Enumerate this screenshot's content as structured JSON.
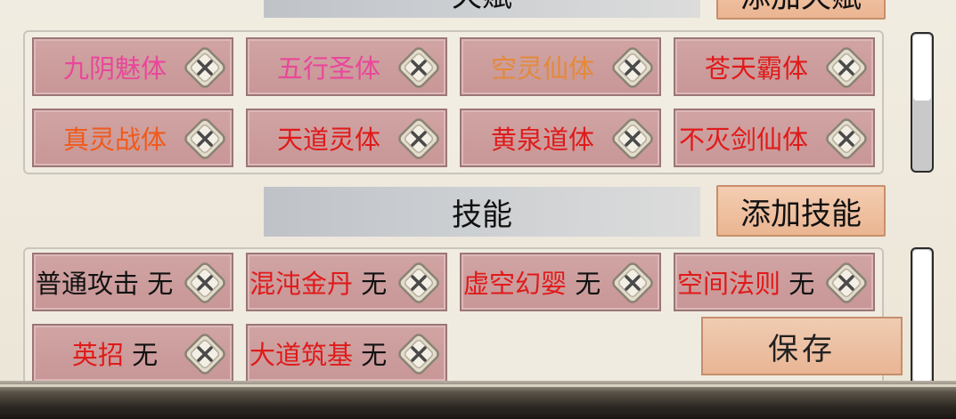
{
  "talents": {
    "header_title": "天赋",
    "add_button": "添加天赋",
    "items": [
      {
        "name": "九阴魅体",
        "color": "#e9479a"
      },
      {
        "name": "五行圣体",
        "color": "#e9479a"
      },
      {
        "name": "空灵仙体",
        "color": "#e38a3a"
      },
      {
        "name": "苍天霸体",
        "color": "#e01a1a"
      },
      {
        "name": "真灵战体",
        "color": "#f05a1a"
      },
      {
        "name": "天道灵体",
        "color": "#e01a1a"
      },
      {
        "name": "黄泉道体",
        "color": "#e01a1a"
      },
      {
        "name": "不灭剑仙体",
        "color": "#e01a1a"
      }
    ]
  },
  "skills": {
    "header_title": "技能",
    "add_button": "添加技能",
    "items": [
      {
        "name": "普通攻击",
        "level": "无",
        "color": "#111111"
      },
      {
        "name": "混沌金丹",
        "level": "无",
        "color": "#e01a1a"
      },
      {
        "name": "虚空幻婴",
        "level": "无",
        "color": "#e01a1a"
      },
      {
        "name": "空间法则",
        "level": "无",
        "color": "#e01a1a"
      },
      {
        "name": "英招",
        "level": "无",
        "color": "#e01a1a"
      },
      {
        "name": "大道筑基",
        "level": "无",
        "color": "#e01a1a"
      }
    ]
  },
  "save_button": "保存",
  "icons": {
    "remove": "close-x-icon"
  }
}
